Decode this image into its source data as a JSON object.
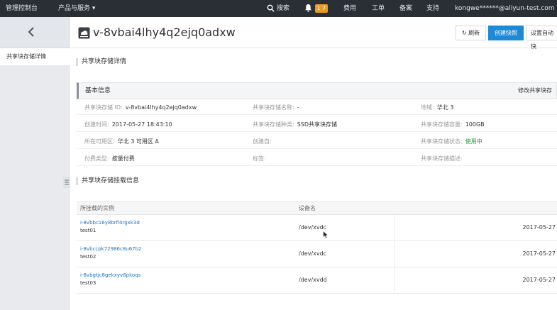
{
  "topbar": {
    "console": "管理控制台",
    "products": "产品与服务",
    "search": "搜索",
    "badge": "1 7",
    "billing": "费用",
    "tickets": "工单",
    "icp": "备案",
    "support": "支持",
    "account": "kongwe******@aliyun-test.com"
  },
  "nav": {
    "active_item": "共享块存储详情"
  },
  "header": {
    "title": "v-8vbai4lhy4q2ejq0adxw",
    "refresh_label": "刷新",
    "create_snapshot_label": "创建快照",
    "auto_snapshot_label": "设置自动快"
  },
  "details_section": {
    "title": "共享块存储详情"
  },
  "basic_info": {
    "title": "基本信息",
    "edit_label": "修改共享块存",
    "fields": {
      "id": {
        "key": "共享块存储 ID:",
        "value": "v-8vbai4lhy4q2ejq0adxw"
      },
      "name": {
        "key": "共享块存储名称:",
        "value": "-"
      },
      "region": {
        "key": "地域:",
        "value": "华北 3"
      },
      "created": {
        "key": "创建时间:",
        "value": "2017-05-27 18:43:10"
      },
      "type": {
        "key": "共享块存储种类:",
        "value": "SSD共享块存储"
      },
      "capacity": {
        "key": "共享块存储容量:",
        "value": "100GB"
      },
      "zone": {
        "key": "所在可用区:",
        "value": "华北 3 可用区 A"
      },
      "creator": {
        "key": "创建自:",
        "value": ""
      },
      "status": {
        "key": "共享块存储状态:",
        "value": "使用中"
      },
      "billing": {
        "key": "付费类型:",
        "value": "按量付费"
      },
      "tags": {
        "key": "标签:",
        "value": ""
      },
      "description": {
        "key": "共享块存储描述:",
        "value": ""
      }
    }
  },
  "mount_section": {
    "title": "共享块存储挂载信息",
    "columns": [
      "所挂载的实例",
      "设备名"
    ],
    "rows": [
      {
        "instance_id": "i-8vbbc16y8brfi4rgxk3d",
        "instance_name": "test01",
        "device": "/dev/xvdc",
        "date": "2017-05-27"
      },
      {
        "instance_id": "i-8vbccpk72986c8u67b2",
        "instance_name": "test02",
        "device": "/dev/xvdc",
        "date": "2017-05-27"
      },
      {
        "instance_id": "i-8vbgtjc8gekxyv8pkoqs",
        "instance_name": "test03",
        "device": "/dev/xvdd",
        "date": "2017-05-27"
      }
    ]
  },
  "colors": {
    "topbar": "#2a2f35",
    "primary": "#1e8ad6",
    "badge": "#e99a24",
    "link": "#1e73be",
    "status_ok": "#1ea33a"
  }
}
